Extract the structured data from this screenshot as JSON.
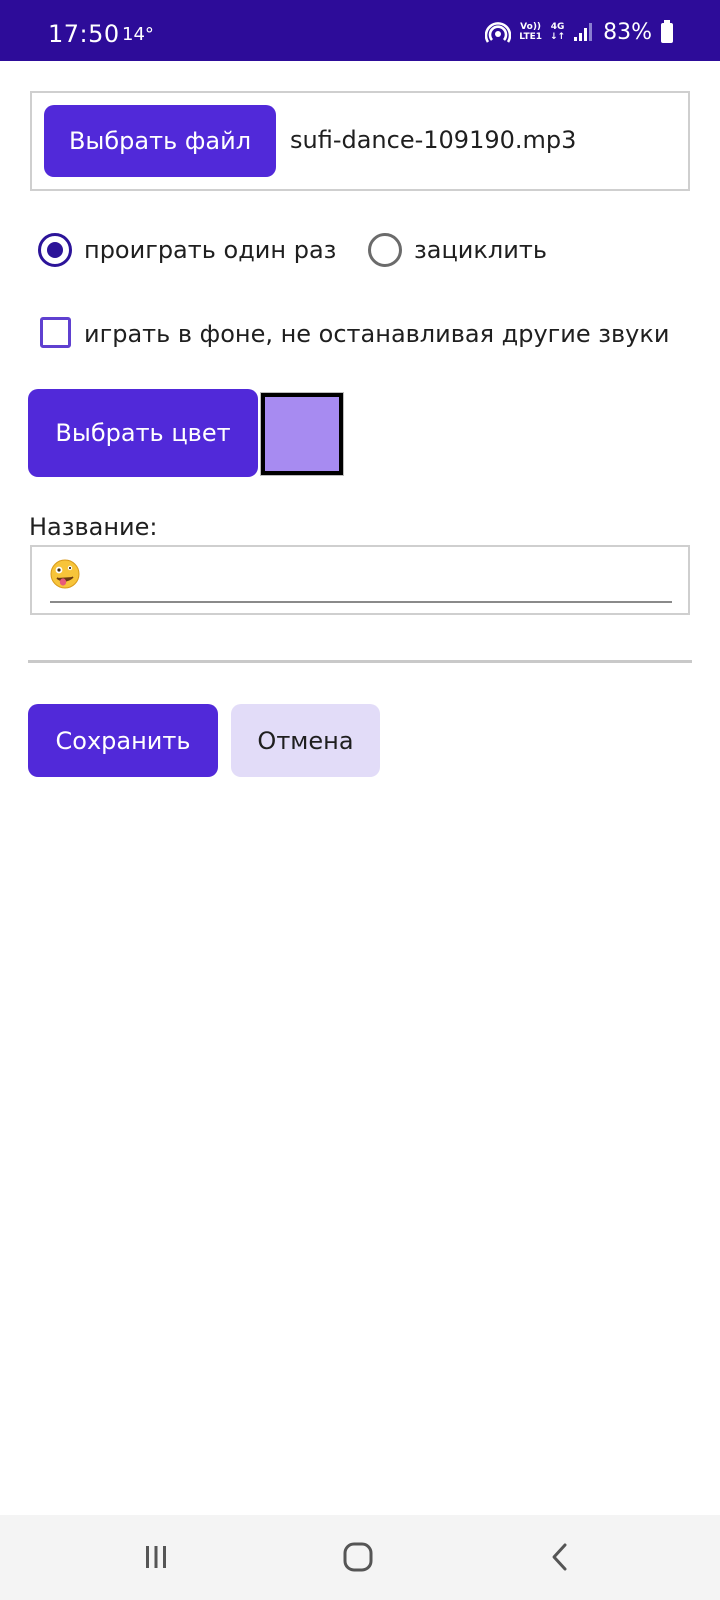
{
  "status_bar": {
    "time": "17:50",
    "temperature": "14°",
    "network_top": "Vo))",
    "network_bottom": "LTE1",
    "network_type": "4G",
    "battery_percent": "83%",
    "icons": [
      "hotspot-icon",
      "signal-icon",
      "battery-icon"
    ]
  },
  "file_picker": {
    "button_label": "Выбрать файл",
    "file_name": "sufi-dance-109190.mp3"
  },
  "playback_mode": {
    "options": [
      {
        "label": "проиграть один раз",
        "selected": true
      },
      {
        "label": "зациклить",
        "selected": false
      }
    ]
  },
  "background_play": {
    "label": "играть в фоне, не останавливая другие звуки",
    "checked": false
  },
  "color_picker": {
    "button_label": "Выбрать цвет",
    "selected_color": "#a78bf1"
  },
  "name_field": {
    "label": "Название:",
    "value": "🤪"
  },
  "actions": {
    "save_label": "Сохранить",
    "cancel_label": "Отмена"
  },
  "colors": {
    "status_bar": "#2d0c99",
    "primary": "#5129d9",
    "secondary": "#e2dcf8"
  },
  "nav_bar": {
    "icons": [
      "recent-apps-icon",
      "home-icon",
      "back-icon"
    ]
  }
}
